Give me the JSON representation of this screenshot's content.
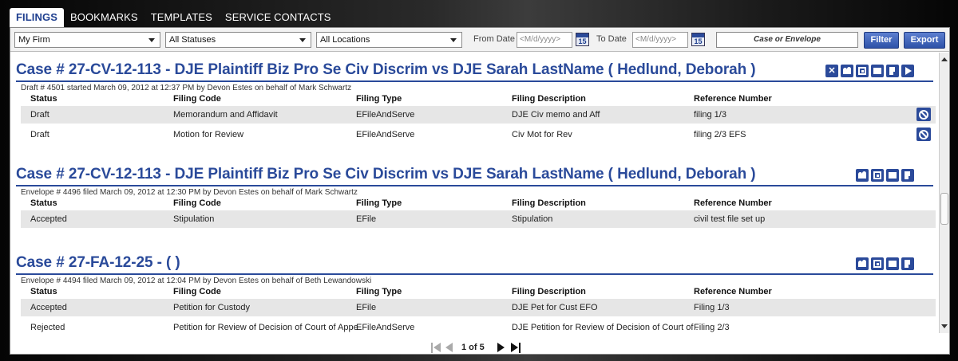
{
  "tabs": [
    "FILINGS",
    "BOOKMARKS",
    "TEMPLATES",
    "SERVICE CONTACTS"
  ],
  "filters": {
    "firm": "My Firm",
    "status": "All Statuses",
    "location": "All Locations",
    "from_label": "From Date",
    "from_placeholder": "<M/d/yyyy>",
    "to_label": "To Date",
    "to_placeholder": "<M/d/yyyy>",
    "calendar_day": "15",
    "search_placeholder": "Case or Envelope",
    "filter_label": "Filter",
    "export_label": "Export"
  },
  "columns": [
    "Status",
    "Filing Code",
    "Filing Type",
    "Filing Description",
    "Reference Number"
  ],
  "cases": [
    {
      "title": "Case # 27-CV-12-113 -  DJE Plaintiff Biz Pro Se Civ Discrim vs DJE Sarah LastName ( Hedlund, Deborah )",
      "meta": "Draft # 4501 started March 09, 2012 at 12:37 PM by Devon Estes on behalf of Mark Schwartz",
      "rows": [
        [
          "Draft",
          "Memorandum and Affidavit",
          "EFileAndServe",
          "DJE Civ memo and Aff",
          "filing 1/3"
        ],
        [
          "Draft",
          "Motion for Review",
          "EFileAndServe",
          "Civ Mot for Rev",
          "filing 2/3 EFS"
        ]
      ]
    },
    {
      "title": "Case # 27-CV-12-113 -  DJE Plaintiff Biz Pro Se Civ Discrim vs DJE Sarah LastName ( Hedlund, Deborah )",
      "meta": "Envelope # 4496 filed March 09, 2012 at 12:30 PM by Devon Estes on behalf of Mark Schwartz",
      "rows": [
        [
          "Accepted",
          "Stipulation",
          "EFile",
          "Stipulation",
          "civil test file set up"
        ]
      ]
    },
    {
      "title": "Case # 27-FA-12-25 -  ( )",
      "meta": "Envelope # 4494 filed March 09, 2012 at 12:04 PM by Devon Estes on behalf of Beth Lewandowski",
      "rows": [
        [
          "Accepted",
          "Petition for Custody",
          "EFile",
          "DJE Pet for Cust EFO",
          "Filing 1/3"
        ],
        [
          "Rejected",
          "Petition for Review of Decision of Court of Appe",
          "EFileAndServe",
          "DJE Petition for Review of Decision of Court of .",
          "Filing 2/3"
        ]
      ]
    }
  ],
  "pager": {
    "text": "1 of 5"
  },
  "icon_labels": {
    "close": "✕"
  },
  "colors": {
    "accent": "#2a4a9a",
    "alt_row": "#e6e6e6"
  }
}
